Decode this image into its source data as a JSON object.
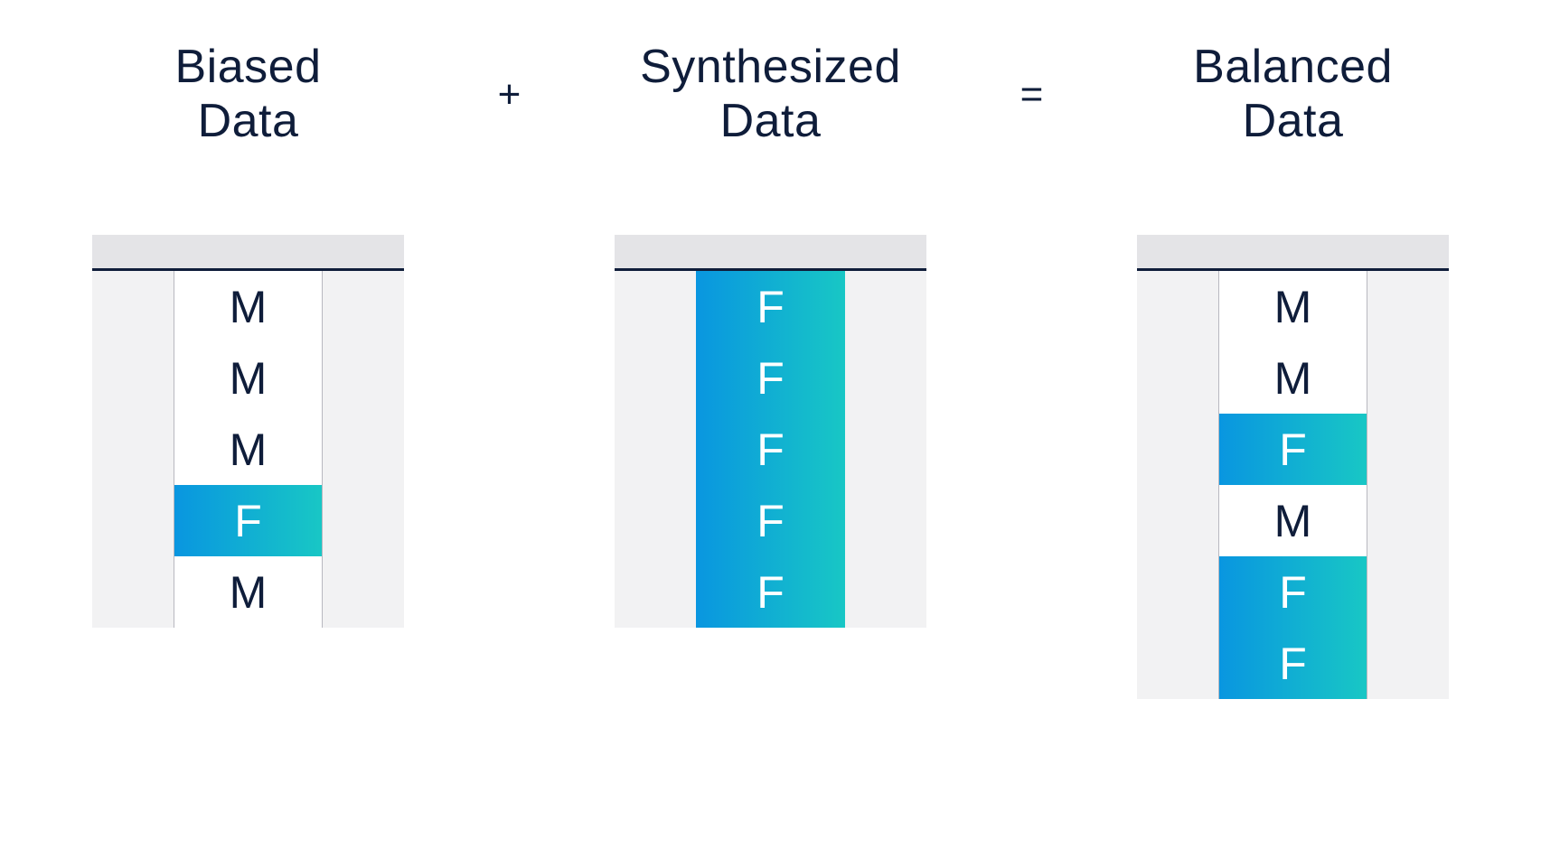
{
  "operators": {
    "plus": "+",
    "equals": "="
  },
  "columns": [
    {
      "title": "Biased\nData",
      "rows": [
        {
          "value": "M",
          "highlight": false
        },
        {
          "value": "M",
          "highlight": false
        },
        {
          "value": "M",
          "highlight": false
        },
        {
          "value": "F",
          "highlight": true
        },
        {
          "value": "M",
          "highlight": false
        }
      ],
      "body_height_rows": 5,
      "all_highlight": false
    },
    {
      "title": "Synthesized\nData",
      "rows": [
        {
          "value": "F",
          "highlight": true
        },
        {
          "value": "F",
          "highlight": true
        },
        {
          "value": "F",
          "highlight": true
        },
        {
          "value": "F",
          "highlight": true
        },
        {
          "value": "F",
          "highlight": true
        }
      ],
      "body_height_rows": 5,
      "all_highlight": true
    },
    {
      "title": "Balanced\nData",
      "rows": [
        {
          "value": "M",
          "highlight": false
        },
        {
          "value": "M",
          "highlight": false
        },
        {
          "value": "F",
          "highlight": true
        },
        {
          "value": "M",
          "highlight": false
        },
        {
          "value": "F",
          "highlight": true
        },
        {
          "value": "F",
          "highlight": true
        }
      ],
      "body_height_rows": 6,
      "all_highlight": false
    }
  ]
}
